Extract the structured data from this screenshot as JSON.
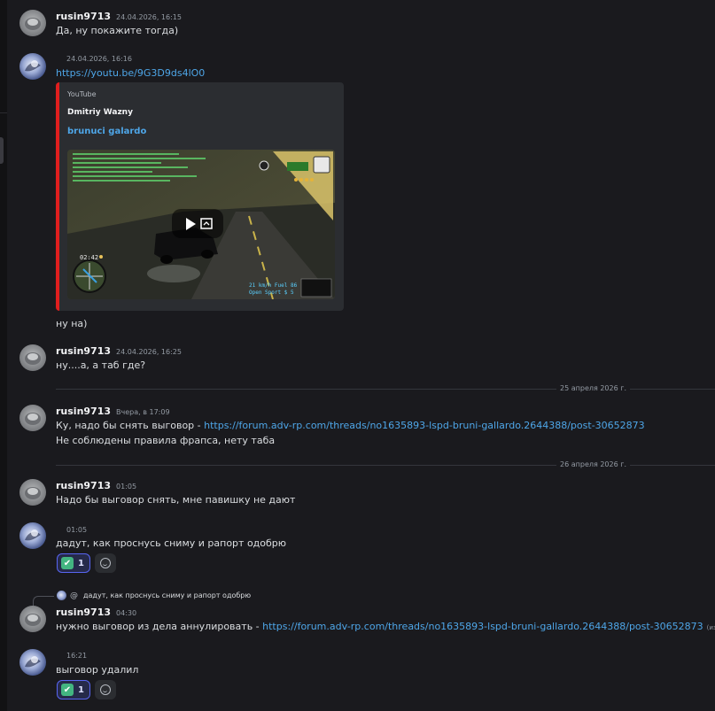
{
  "messages": {
    "m1": {
      "author": "rusin9713",
      "time": "24.04.2026, 16:15",
      "text": "Да, ну покажите тогда)"
    },
    "m2": {
      "time": "24.04.2026, 16:16",
      "link": "https://youtu.be/9G3D9ds4lO0",
      "embed": {
        "provider": "YouTube",
        "author": "Dmitriy Wazny",
        "title": "brunuci galardo",
        "thumbnail_time": "02:42",
        "thumbnail_hud_speed": "21 km/h   Fuel 86",
        "thumbnail_hud_state": "Open   Sport   $ 5"
      },
      "text2": "ну на)"
    },
    "m3": {
      "author": "rusin9713",
      "time": "24.04.2026, 16:25",
      "text": "ну....а, а таб где?"
    },
    "divider1": "25 апреля 2026 г.",
    "m4": {
      "author": "rusin9713",
      "time": "Вчера, в 17:09",
      "text_prefix": "Ку, надо бы снять выговор - ",
      "link": "https://forum.adv-rp.com/threads/no1635893-lspd-bruni-gallardo.2644388/post-30652873",
      "text2": "Не соблюдены правила фрапса, нету таба"
    },
    "divider2": "26 апреля 2026 г.",
    "m5": {
      "author": "rusin9713",
      "time": "01:05",
      "text": "Надо бы выговор снять, мне павишку не дают"
    },
    "m6": {
      "time": "01:05",
      "text": "дадут, как проснусь сниму и рапорт одобрю",
      "reaction_count": "1"
    },
    "m7": {
      "reply_at": "@",
      "reply_text": "дадут, как проснусь сниму и рапорт одобрю",
      "author": "rusin9713",
      "time": "04:30",
      "text_prefix": "нужно выговор из дела аннулировать - ",
      "link": "https://forum.adv-rp.com/threads/no1635893-lspd-bruni-gallardo.2644388/post-30652873",
      "edited": "(изменено)"
    },
    "m8": {
      "time": "16:21",
      "text": "выговор удалил",
      "reaction_count": "1"
    }
  },
  "reaction_emoji": "✔",
  "icons": {
    "reaction": "check-mark-button-emoji",
    "add_reaction": "smile-add-reaction-icon",
    "play": "play-icon",
    "open": "open-external-icon"
  },
  "colors": {
    "background": "#1a1a1e",
    "link": "#4ea6e8",
    "embed_accent": "#e01e1e",
    "reaction_border": "#5865f2"
  }
}
